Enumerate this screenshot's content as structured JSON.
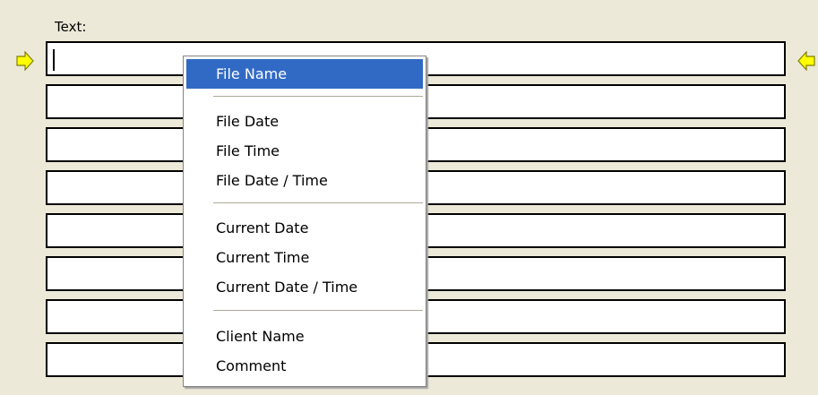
{
  "panel": {
    "text_label": "Text:"
  },
  "fields": [
    {
      "value": ""
    },
    {
      "value": ""
    },
    {
      "value": ""
    },
    {
      "value": ""
    },
    {
      "value": ""
    },
    {
      "value": ""
    },
    {
      "value": ""
    },
    {
      "value": ""
    }
  ],
  "indicators": {
    "left_icon": "arrow-right-icon",
    "right_icon": "arrow-left-icon",
    "color": "#ffff00"
  },
  "context_menu": {
    "selected_color": "#316ac5",
    "items": [
      {
        "label": "File Name"
      },
      {
        "label": "File Date"
      },
      {
        "label": "File Time"
      },
      {
        "label": "File Date / Time"
      },
      {
        "label": "Current Date"
      },
      {
        "label": "Current Time"
      },
      {
        "label": "Current Date / Time"
      },
      {
        "label": "Client Name"
      },
      {
        "label": "Comment"
      }
    ]
  }
}
